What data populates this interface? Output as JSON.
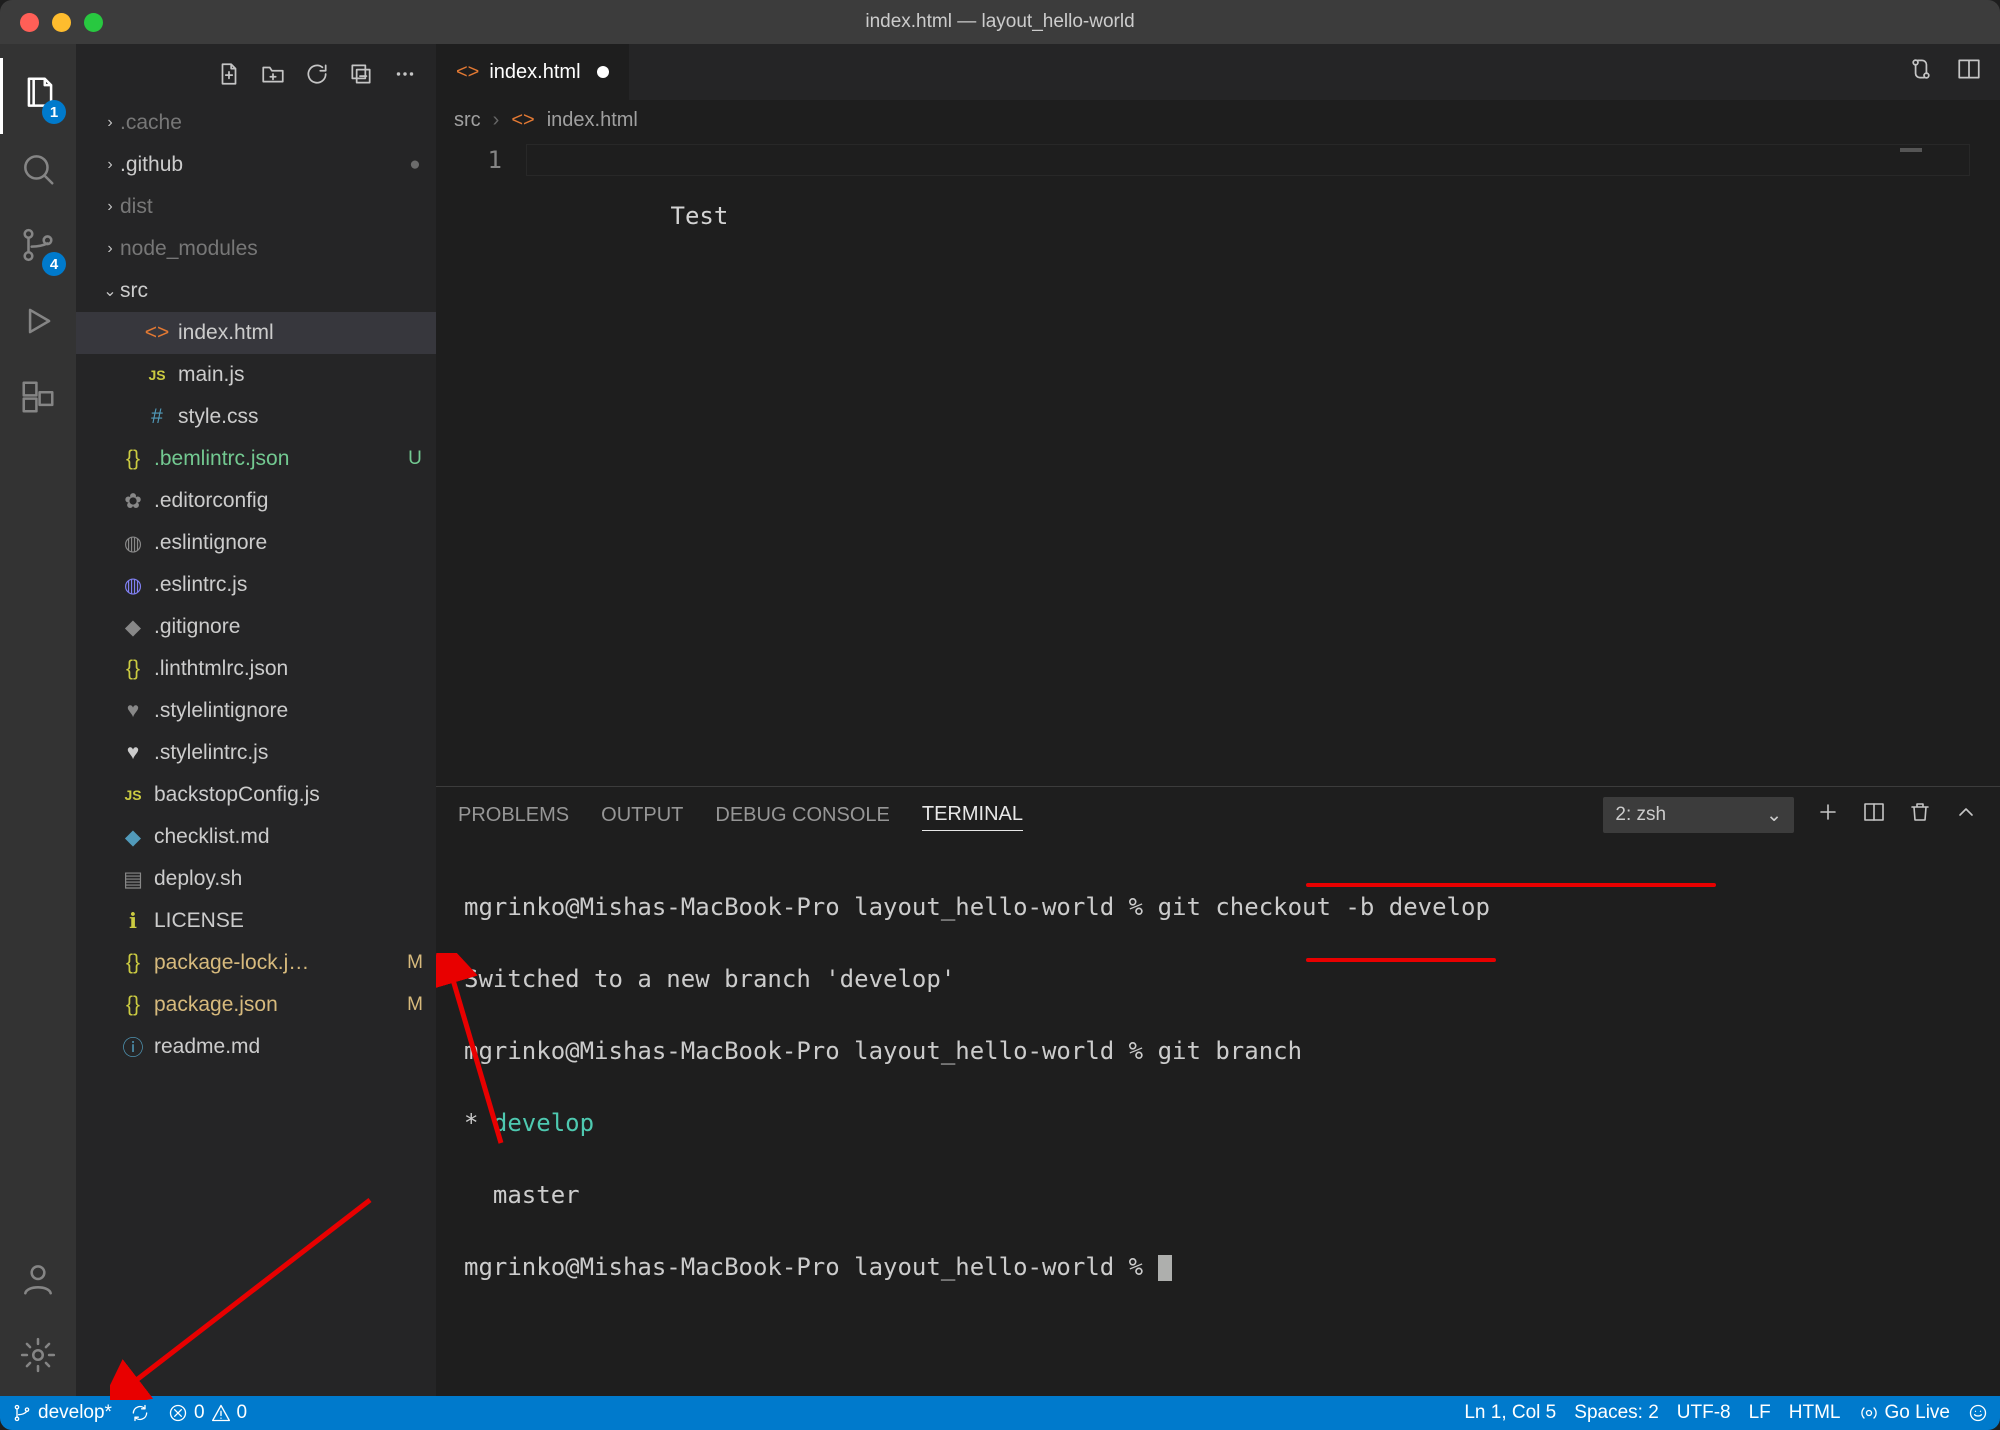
{
  "window": {
    "title": "index.html — layout_hello-world"
  },
  "activitybar": {
    "explorer_badge": "1",
    "scm_badge": "4"
  },
  "sidebar": {
    "actions": {
      "newfile": "New File",
      "newfolder": "New Folder",
      "refresh": "Refresh",
      "collapse": "Collapse"
    },
    "tree": {
      "cache": ".cache",
      "github": ".github",
      "dist": "dist",
      "node_modules": "node_modules",
      "src": "src",
      "index_html": "index.html",
      "main_js": "main.js",
      "style_css": "style.css",
      "bemlintrc": ".bemlintrc.json",
      "editorconfig": ".editorconfig",
      "eslintignore": ".eslintignore",
      "eslintrc": ".eslintrc.js",
      "gitignore": ".gitignore",
      "linthtmlrc": ".linthtmlrc.json",
      "stylelintignore": ".stylelintignore",
      "stylelintrc": ".stylelintrc.js",
      "backstop": "backstopConfig.js",
      "checklist": "checklist.md",
      "deploy": "deploy.sh",
      "license": "LICENSE",
      "package_lock": "package-lock.j…",
      "package_json": "package.json",
      "readme": "readme.md",
      "status_U": "U",
      "status_M": "M"
    }
  },
  "tabs": {
    "index_html": "index.html"
  },
  "breadcrumbs": {
    "src": "src",
    "index_html": "index.html"
  },
  "editor": {
    "line1_num": "1",
    "line1_text": "Test"
  },
  "panel": {
    "tabs": {
      "problems": "PROBLEMS",
      "output": "OUTPUT",
      "debug": "DEBUG CONSOLE",
      "terminal": "TERMINAL"
    },
    "picker": "2: zsh",
    "lines": {
      "p1_prompt": "mgrinko@Mishas-MacBook-Pro layout_hello-world % ",
      "p1_cmd": "git checkout -b develop",
      "p1_out": "Switched to a new branch 'develop'",
      "p2_prompt": "mgrinko@Mishas-MacBook-Pro layout_hello-world % ",
      "p2_cmd": "git branch",
      "b_star": "* ",
      "b_develop": "develop",
      "b_master": "  master",
      "p3_prompt": "mgrinko@Mishas-MacBook-Pro layout_hello-world % "
    }
  },
  "statusbar": {
    "branch": "develop*",
    "errors": "0",
    "warnings": "0",
    "ln_col": "Ln 1, Col 5",
    "spaces": "Spaces: 2",
    "encoding": "UTF-8",
    "eol": "LF",
    "lang": "HTML",
    "golive": "Go Live"
  }
}
